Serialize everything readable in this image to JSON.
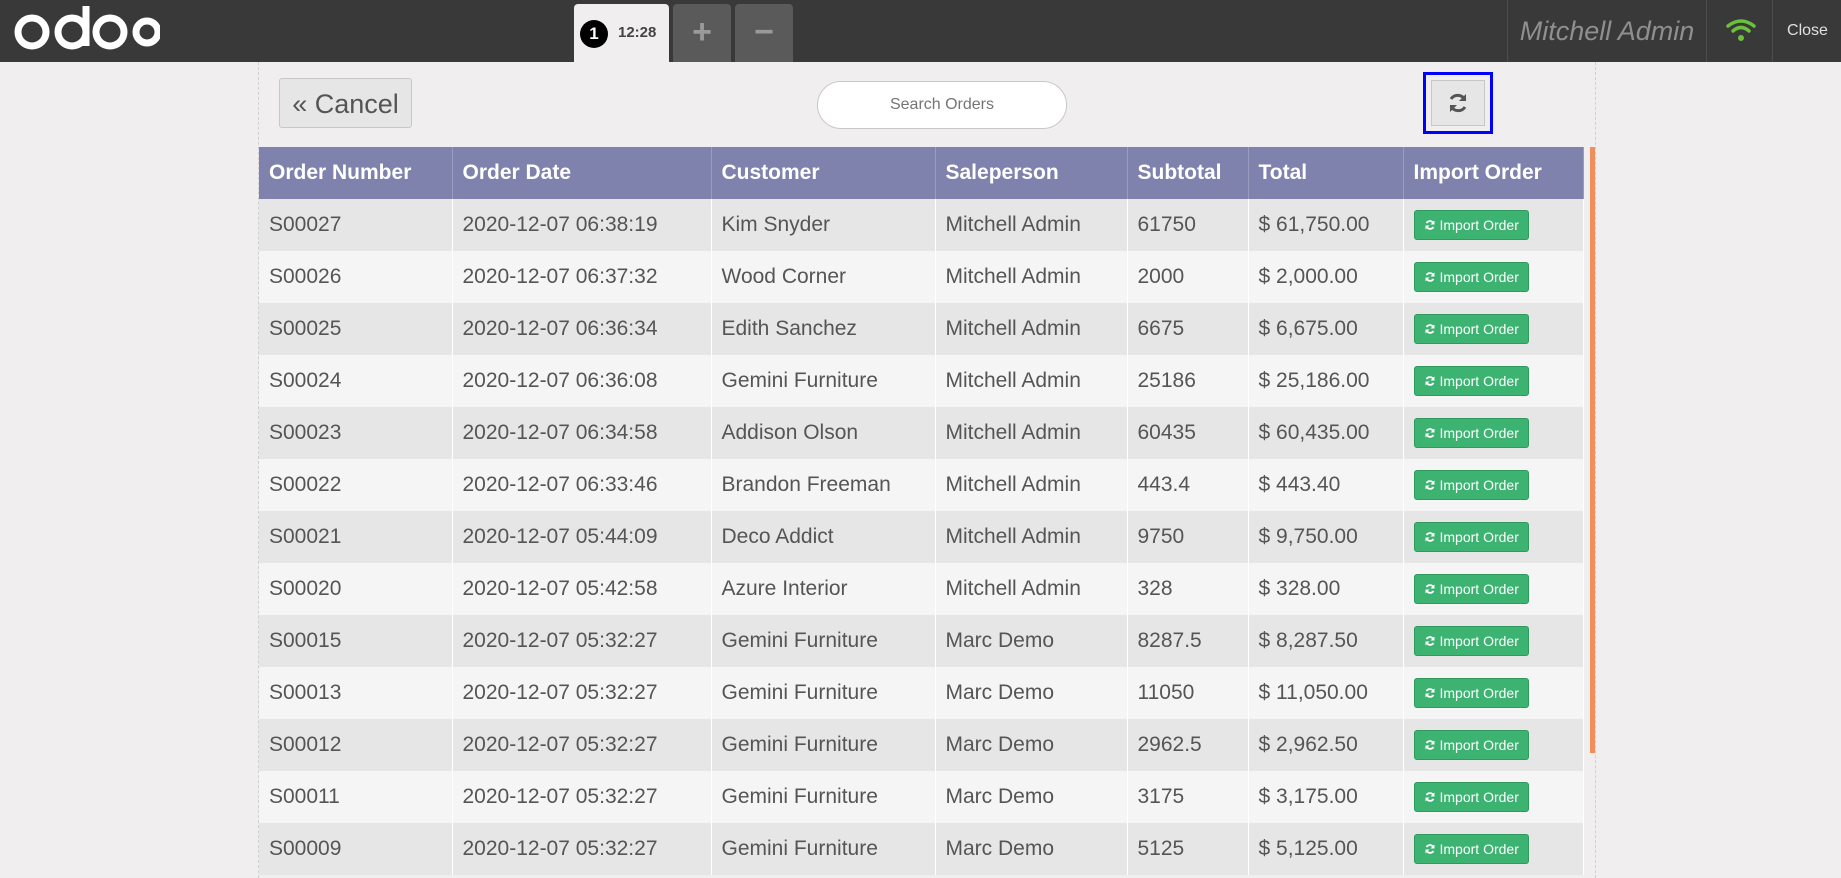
{
  "header": {
    "logo_text": "odoo",
    "order_tab": {
      "number": "1",
      "time": "12:28"
    },
    "add_label": "+",
    "remove_label": "−",
    "user_name": "Mitchell Admin",
    "close_label": "Close"
  },
  "toolbar": {
    "cancel_label": "« Cancel",
    "search_placeholder": "Search Orders"
  },
  "table": {
    "columns": [
      "Order Number",
      "Order Date",
      "Customer",
      "Saleperson",
      "Subtotal",
      "Total",
      "Import Order"
    ],
    "import_label": "Import Order",
    "rows": [
      [
        "S00027",
        "2020-12-07 06:38:19",
        "Kim Snyder",
        "Mitchell Admin",
        "61750",
        "$ 61,750.00"
      ],
      [
        "S00026",
        "2020-12-07 06:37:32",
        "Wood Corner",
        "Mitchell Admin",
        "2000",
        "$ 2,000.00"
      ],
      [
        "S00025",
        "2020-12-07 06:36:34",
        "Edith Sanchez",
        "Mitchell Admin",
        "6675",
        "$ 6,675.00"
      ],
      [
        "S00024",
        "2020-12-07 06:36:08",
        "Gemini Furniture",
        "Mitchell Admin",
        "25186",
        "$ 25,186.00"
      ],
      [
        "S00023",
        "2020-12-07 06:34:58",
        "Addison Olson",
        "Mitchell Admin",
        "60435",
        "$ 60,435.00"
      ],
      [
        "S00022",
        "2020-12-07 06:33:46",
        "Brandon Freeman",
        "Mitchell Admin",
        "443.4",
        "$ 443.40"
      ],
      [
        "S00021",
        "2020-12-07 05:44:09",
        "Deco Addict",
        "Mitchell Admin",
        "9750",
        "$ 9,750.00"
      ],
      [
        "S00020",
        "2020-12-07 05:42:58",
        "Azure Interior",
        "Mitchell Admin",
        "328",
        "$ 328.00"
      ],
      [
        "S00015",
        "2020-12-07 05:32:27",
        "Gemini Furniture",
        "Marc Demo",
        "8287.5",
        "$ 8,287.50"
      ],
      [
        "S00013",
        "2020-12-07 05:32:27",
        "Gemini Furniture",
        "Marc Demo",
        "11050",
        "$ 11,050.00"
      ],
      [
        "S00012",
        "2020-12-07 05:32:27",
        "Gemini Furniture",
        "Marc Demo",
        "2962.5",
        "$ 2,962.50"
      ],
      [
        "S00011",
        "2020-12-07 05:32:27",
        "Gemini Furniture",
        "Marc Demo",
        "3175",
        "$ 3,175.00"
      ],
      [
        "S00009",
        "2020-12-07 05:32:27",
        "Gemini Furniture",
        "Marc Demo",
        "5125",
        "$ 5,125.00"
      ]
    ]
  },
  "colors": {
    "header_bg": "#393939",
    "table_header": "#7f82ac",
    "import_button": "#3cb371",
    "scroll_accent": "#f08f5c",
    "focus_outline": "#0000ff"
  }
}
